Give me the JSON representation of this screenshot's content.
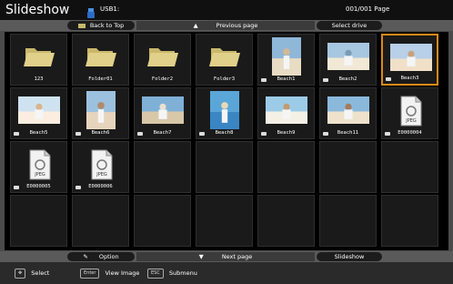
{
  "title_bar": {
    "app_title": "Slideshow",
    "drive_label": "USB1:",
    "page_indicator": "001/001 Page"
  },
  "top_nav": {
    "back_label": "Back to Top",
    "prev_label": "Previous page",
    "select_drive_label": "Select drive"
  },
  "bottom_nav": {
    "option_label": "Option",
    "next_label": "Next page",
    "slideshow_label": "Slideshow"
  },
  "hints": {
    "select": "Select",
    "enter_key": "Enter",
    "view_image": "View Image",
    "esc_key": "ESC",
    "submenu": "Submenu"
  },
  "items": [
    {
      "label": "123",
      "type": "folder"
    },
    {
      "label": "Folder01",
      "type": "folder"
    },
    {
      "label": "Folder2",
      "type": "folder"
    },
    {
      "label": "Folder3",
      "type": "folder"
    },
    {
      "label": "Beach1",
      "type": "photo"
    },
    {
      "label": "Beach2",
      "type": "photo"
    },
    {
      "label": "Beach3",
      "type": "photo",
      "selected": true
    },
    {
      "label": "Beach5",
      "type": "photo"
    },
    {
      "label": "Beach6",
      "type": "photo"
    },
    {
      "label": "Beach7",
      "type": "photo"
    },
    {
      "label": "Beach8",
      "type": "photo"
    },
    {
      "label": "Beach9",
      "type": "photo"
    },
    {
      "label": "Beach11",
      "type": "photo"
    },
    {
      "label": "E0000004",
      "type": "jpeg"
    },
    {
      "label": "E0000005",
      "type": "jpeg"
    },
    {
      "label": "E0000006",
      "type": "jpeg"
    }
  ],
  "jpeg_icon_text": "JPEG",
  "colors": {
    "selection": "#d98a1a",
    "folder": "#e0d08a",
    "background": "#000000"
  }
}
